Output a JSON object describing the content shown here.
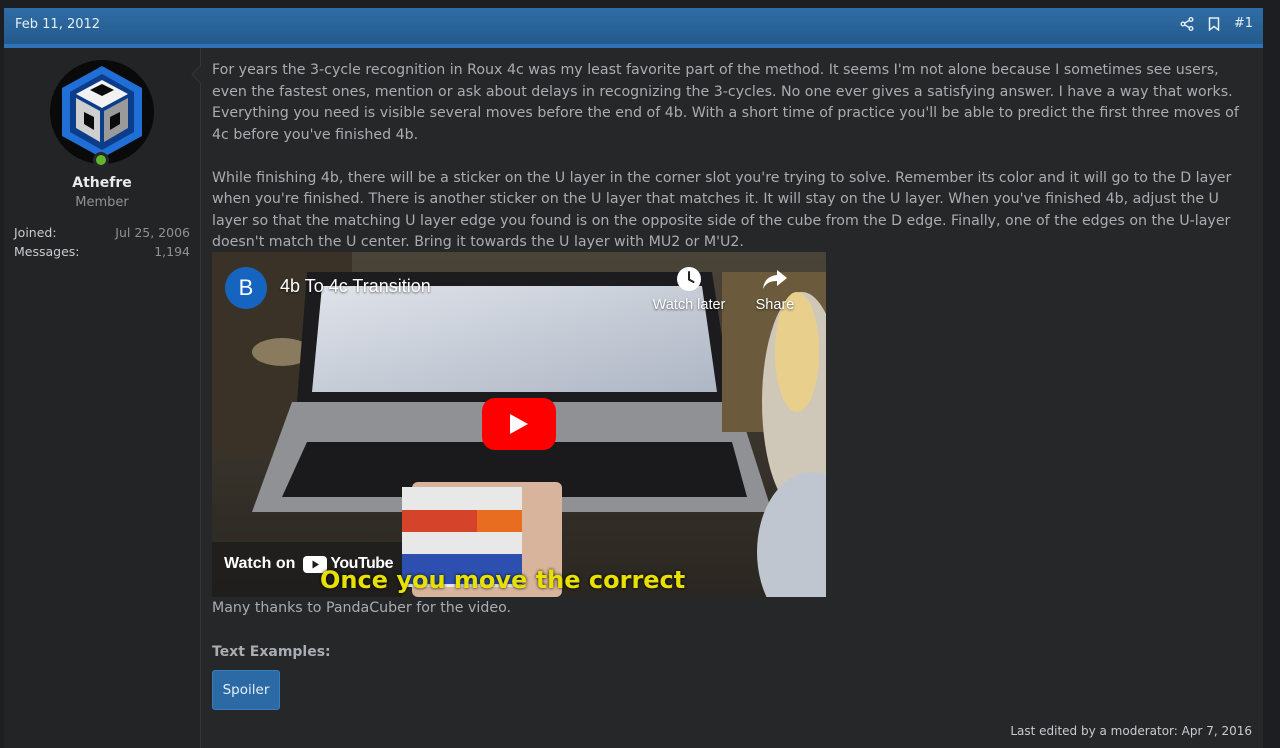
{
  "post": {
    "date": "Feb 11, 2012",
    "number": "#1",
    "last_edited": "Last edited by a moderator: Apr 7, 2016"
  },
  "user": {
    "name": "Athefre",
    "title": "Member",
    "stats": [
      {
        "label": "Joined:",
        "value": "Jul 25, 2006"
      },
      {
        "label": "Messages:",
        "value": "1,194"
      }
    ]
  },
  "body": {
    "paragraph1": "For years the 3-cycle recognition in Roux 4c was my least favorite part of the method. It seems I'm not alone because I sometimes see users, even the fastest ones, mention or ask about delays in recognizing the 3-cycles. No one ever gives a satisfying answer. I have a way that works. Everything you need is visible several moves before the end of 4b. With a short time of practice you'll be able to predict the first three moves of 4c before you've finished 4b.",
    "paragraph2": "While finishing 4b, there will be a sticker on the U layer in the corner slot you're trying to solve. Remember its color and it will go to the D layer when you're finished. There is another sticker on the U layer that matches it. It will stay on the U layer. When you've finished 4b, adjust the U layer so that the matching U layer edge you found is on the opposite side of the cube from the D edge. Finally, one of the edges on the U-layer doesn't match the U center. Bring it towards the U layer with MU2 or M'U2.",
    "thanks": "Many thanks to PandaCuber for the video.",
    "text_examples": "Text Examples:",
    "spoiler_label": "Spoiler"
  },
  "video": {
    "channel_letter": "B",
    "title": "4b To 4c Transition",
    "watch_later": "Watch later",
    "share": "Share",
    "watch_on": "Watch on",
    "youtube_brand": "YouTube",
    "subtitle": "Once you move the correct"
  },
  "colors": {
    "header": "#2a6399",
    "accent": "#2c6aa6",
    "online": "#63b52b",
    "youtube_red": "#ff0000"
  }
}
